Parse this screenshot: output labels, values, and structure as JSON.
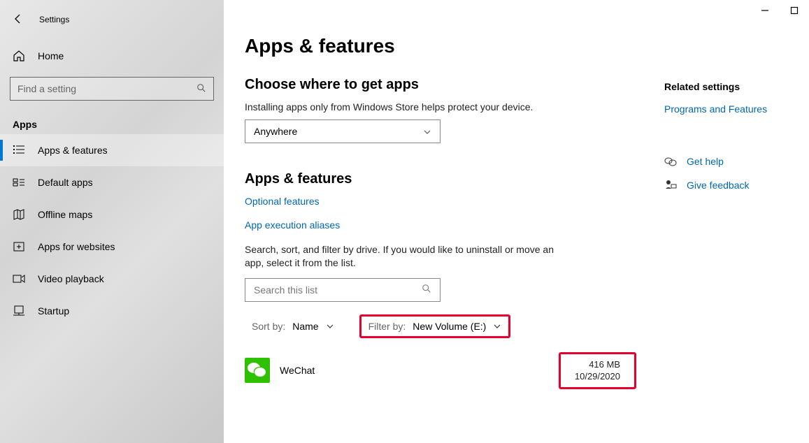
{
  "window": {
    "title": "Settings"
  },
  "sidebar": {
    "home": "Home",
    "search_placeholder": "Find a setting",
    "section": "Apps",
    "items": [
      {
        "label": "Apps & features"
      },
      {
        "label": "Default apps"
      },
      {
        "label": "Offline maps"
      },
      {
        "label": "Apps for websites"
      },
      {
        "label": "Video playback"
      },
      {
        "label": "Startup"
      }
    ]
  },
  "main": {
    "title": "Apps & features",
    "choose": {
      "heading": "Choose where to get apps",
      "desc": "Installing apps only from Windows Store helps protect your device.",
      "selected": "Anywhere"
    },
    "features": {
      "heading": "Apps & features",
      "optional_link": "Optional features",
      "aliases_link": "App execution aliases",
      "desc": "Search, sort, and filter by drive. If you would like to uninstall or move an app, select it from the list.",
      "search_placeholder": "Search this list",
      "sort_label": "Sort by:",
      "sort_value": "Name",
      "filter_label": "Filter by:",
      "filter_value": "New Volume (E:)"
    },
    "apps": [
      {
        "name": "WeChat",
        "size": "416 MB",
        "date": "10/29/2020"
      }
    ]
  },
  "right": {
    "related_heading": "Related settings",
    "programs_link": "Programs and Features",
    "help": "Get help",
    "feedback": "Give feedback"
  }
}
